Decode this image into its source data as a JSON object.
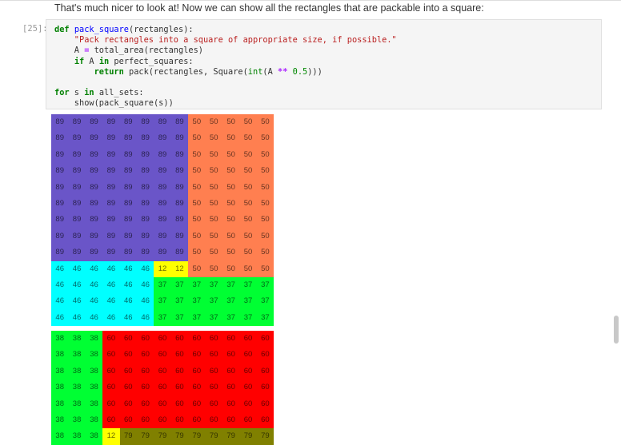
{
  "markdown_text": "That's much nicer to look at! Now we can show all the rectangles that are packable into a square:",
  "cell": {
    "prompt": "[25]:",
    "code_lines": [
      "def pack_square(rectangles):",
      "    \"Pack rectangles into a square of appropriate size, if possible.\"",
      "    A = total_area(rectangles)",
      "    if A in perfect_squares:",
      "        return pack(rectangles, Square(int(A ** 0.5)))",
      "",
      "for s in all_sets:",
      "    show(pack_square(s))"
    ]
  },
  "colors": {
    "89": "#6a55c8",
    "50": "#ff7f50",
    "46": "#00ffff",
    "12": "#ffff00",
    "37": "#00ff33",
    "38": "#00ff33",
    "60": "#ff0000",
    "79": "#808000"
  },
  "grids": [
    [
      [
        89,
        89,
        89,
        89,
        89,
        89,
        89,
        89,
        50,
        50,
        50,
        50,
        50
      ],
      [
        89,
        89,
        89,
        89,
        89,
        89,
        89,
        89,
        50,
        50,
        50,
        50,
        50
      ],
      [
        89,
        89,
        89,
        89,
        89,
        89,
        89,
        89,
        50,
        50,
        50,
        50,
        50
      ],
      [
        89,
        89,
        89,
        89,
        89,
        89,
        89,
        89,
        50,
        50,
        50,
        50,
        50
      ],
      [
        89,
        89,
        89,
        89,
        89,
        89,
        89,
        89,
        50,
        50,
        50,
        50,
        50
      ],
      [
        89,
        89,
        89,
        89,
        89,
        89,
        89,
        89,
        50,
        50,
        50,
        50,
        50
      ],
      [
        89,
        89,
        89,
        89,
        89,
        89,
        89,
        89,
        50,
        50,
        50,
        50,
        50
      ],
      [
        89,
        89,
        89,
        89,
        89,
        89,
        89,
        89,
        50,
        50,
        50,
        50,
        50
      ],
      [
        89,
        89,
        89,
        89,
        89,
        89,
        89,
        89,
        50,
        50,
        50,
        50,
        50
      ],
      [
        46,
        46,
        46,
        46,
        46,
        46,
        12,
        12,
        50,
        50,
        50,
        50,
        50
      ],
      [
        46,
        46,
        46,
        46,
        46,
        46,
        37,
        37,
        37,
        37,
        37,
        37,
        37
      ],
      [
        46,
        46,
        46,
        46,
        46,
        46,
        37,
        37,
        37,
        37,
        37,
        37,
        37
      ],
      [
        46,
        46,
        46,
        46,
        46,
        46,
        37,
        37,
        37,
        37,
        37,
        37,
        37
      ]
    ],
    [
      [
        38,
        38,
        38,
        60,
        60,
        60,
        60,
        60,
        60,
        60,
        60,
        60,
        60
      ],
      [
        38,
        38,
        38,
        60,
        60,
        60,
        60,
        60,
        60,
        60,
        60,
        60,
        60
      ],
      [
        38,
        38,
        38,
        60,
        60,
        60,
        60,
        60,
        60,
        60,
        60,
        60,
        60
      ],
      [
        38,
        38,
        38,
        60,
        60,
        60,
        60,
        60,
        60,
        60,
        60,
        60,
        60
      ],
      [
        38,
        38,
        38,
        60,
        60,
        60,
        60,
        60,
        60,
        60,
        60,
        60,
        60
      ],
      [
        38,
        38,
        38,
        60,
        60,
        60,
        60,
        60,
        60,
        60,
        60,
        60,
        60
      ],
      [
        38,
        38,
        38,
        12,
        79,
        79,
        79,
        79,
        79,
        79,
        79,
        79,
        79
      ]
    ]
  ]
}
